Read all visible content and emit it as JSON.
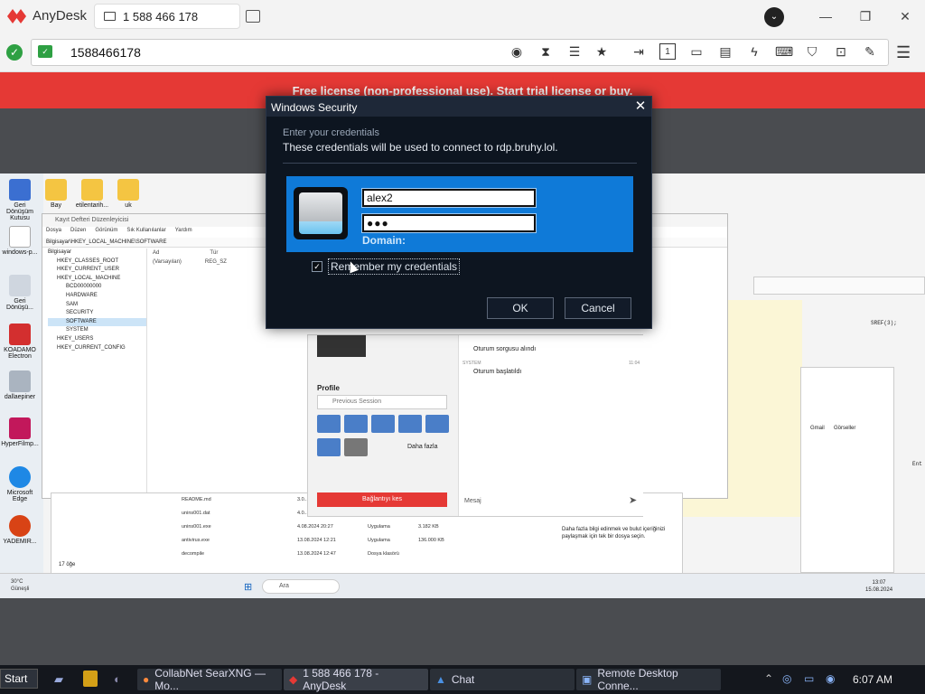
{
  "app": {
    "name": "AnyDesk",
    "tab_label": "1 588 466 178"
  },
  "address": {
    "value": "1588466178"
  },
  "banner": {
    "text": "Free license (non-professional use). Start trial license or buy."
  },
  "dialog": {
    "title": "Windows Security",
    "subtitle": "Enter your credentials",
    "description": "These credentials will be used to connect to rdp.bruhy.lol.",
    "username": "alex2",
    "password_mask": "●●●",
    "domain_label": "Domain:",
    "remember_label": "Remember my credentials",
    "remember_checked": true,
    "ok_label": "OK",
    "cancel_label": "Cancel"
  },
  "remote": {
    "desktop_icons": [
      "Geri Dönüşüm Kutusu",
      "windows-p...",
      "Geri Dönüşü...",
      "KOADAMO Electron",
      "dallaepiner",
      "HyperFilmp...",
      "Microsoft Edge",
      "YADEMIR..."
    ],
    "top_icons": [
      "Bay",
      "etilentarih...",
      "uk"
    ],
    "regedit": {
      "title": "Kayıt Defteri Düzenleyicisi",
      "menu": [
        "Dosya",
        "Düzen",
        "Görünüm",
        "Sık Kullanılanlar",
        "Yardım"
      ],
      "path": "Bilgisayar\\HKEY_LOCAL_MACHINE\\SOFTWARE",
      "tree": [
        "Bilgisayar",
        "HKEY_CLASSES_ROOT",
        "HKEY_CURRENT_USER",
        "HKEY_LOCAL_MACHINE",
        "BCD00000000",
        "HARDWARE",
        "SAM",
        "SECURITY",
        "SOFTWARE",
        "SYSTEM",
        "HKEY_USERS",
        "HKEY_CURRENT_CONFIG"
      ],
      "col_name": "Ad",
      "col_type": "Tür",
      "row_name": "(Varsayılan)",
      "row_type": "REG_SZ"
    },
    "anydesk_panel": {
      "profile_label": "Profile",
      "session_select": "Previous Session",
      "more_label": "Daha fazla",
      "disconnect_label": "Bağlantıyı kes",
      "log_1": "Oturum sorgusu alındı",
      "system_label": "SYSTEM",
      "log_time": "11:04",
      "log_2": "Oturum başlatıldı",
      "message_placeholder": "Mesaj"
    },
    "files": [
      {
        "name": "README.md",
        "date": "3.0...",
        "type": "",
        "size": ""
      },
      {
        "name": "unins001.dat",
        "date": "4.0...",
        "type": "",
        "size": ""
      },
      {
        "name": "unins001.exe",
        "date": "4.08.2024 20:27",
        "type": "Uygulama",
        "size": "3.182 KB"
      },
      {
        "name": "antivirus.exe",
        "date": "13.08.2024 12:21",
        "type": "Uygulama",
        "size": "136.000 KB"
      },
      {
        "name": "decompile",
        "date": "13.08.2024 12:47",
        "type": "Dosya klasörü",
        "size": ""
      }
    ],
    "files_count": "17 öğe",
    "browser_links": [
      "Gmail",
      "Görseller"
    ],
    "toast": "Daha fazla bilgi edinmek ve bulut içeriğinizi paylaşmak için tek bir dosya seçin.",
    "code_snippet": "SREF(3);",
    "code_snippet2": "Ent",
    "weather": {
      "temp": "30°C",
      "cond": "Güneşli"
    },
    "search_placeholder": "Ara",
    "clock": {
      "time": "13:07",
      "date": "15.08.2024"
    }
  },
  "taskbar": {
    "start_label": "Start",
    "items": [
      "CollabNet SearXNG — Mo...",
      "1 588 466 178 - AnyDesk",
      "Chat",
      "Remote Desktop Conne..."
    ],
    "time": "6:07 AM"
  },
  "colors": {
    "accent": "#e53935",
    "dialog_bg": "#0d1520",
    "cred_blue": "#0f7ad8"
  }
}
